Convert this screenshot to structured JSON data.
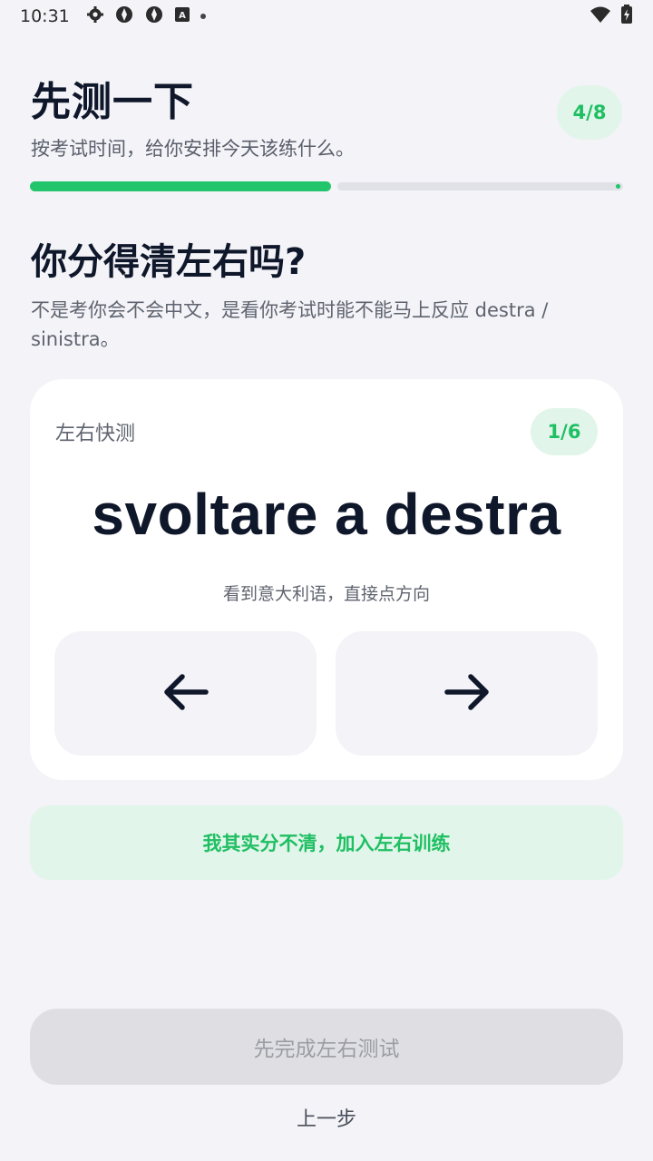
{
  "status_bar": {
    "time": "10:31",
    "icons": [
      "gear-icon",
      "app-icon",
      "app-icon",
      "keyboard-icon"
    ],
    "right_icons": [
      "wifi-icon",
      "battery-icon"
    ]
  },
  "header": {
    "title": "先测一下",
    "subtitle": "按考试时间，给你安排今天该练什么。",
    "step": "4/8",
    "progress_fraction": 0.5
  },
  "question": {
    "title": "你分得清左右吗?",
    "description": "不是考你会不会中文，是看你考试时能不能马上反应 destra / sinistra。"
  },
  "quiz_card": {
    "label": "左右快测",
    "count": "1/6",
    "prompt": "svoltare a destra",
    "hint": "看到意大利语，直接点方向",
    "left_button_icon": "arrow-left-icon",
    "right_button_icon": "arrow-right-icon"
  },
  "train_button": {
    "label": "我其实分不清，加入左右训练"
  },
  "footer": {
    "primary_label": "先完成左右测试",
    "back_label": "上一步"
  },
  "colors": {
    "accent": "#22c56b",
    "accent_soft": "#e2f5ea",
    "background": "#f3f3f8",
    "disabled": "#dfdfe3"
  }
}
